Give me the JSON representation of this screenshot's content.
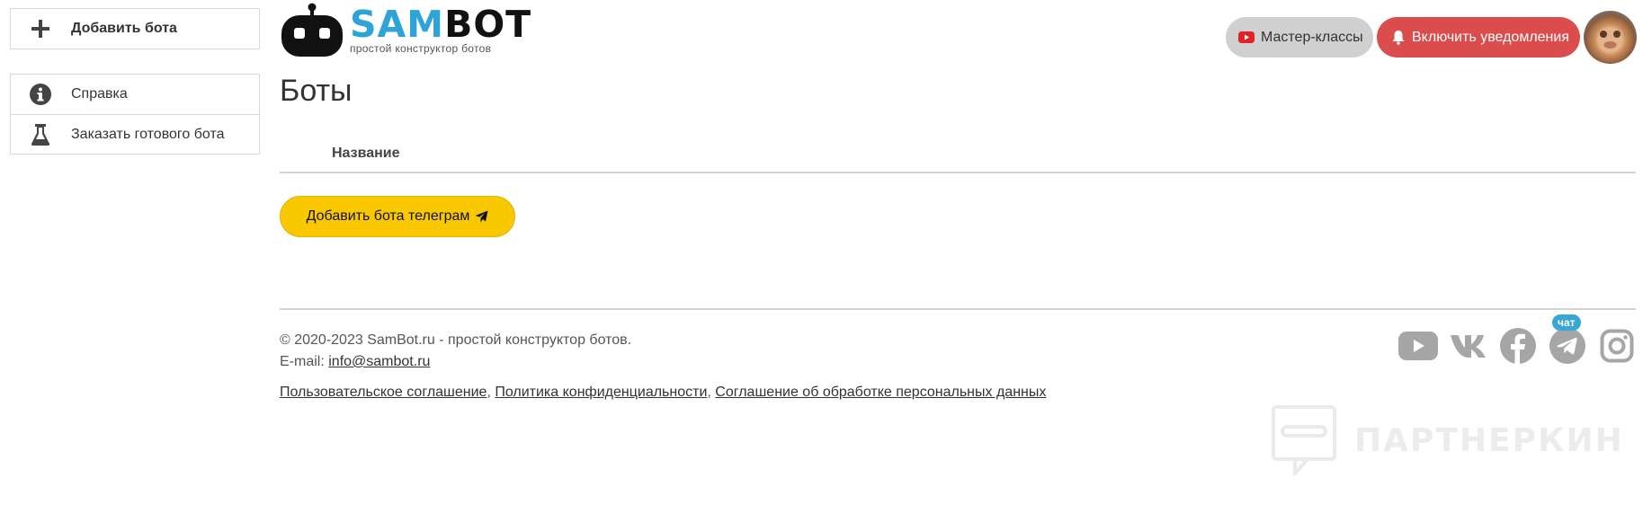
{
  "sidebar": {
    "add_bot": "Добавить бота",
    "items": [
      {
        "label": "Справка",
        "icon": "info-icon"
      },
      {
        "label": "Заказать готового бота",
        "icon": "flask-icon"
      }
    ]
  },
  "logo": {
    "sam": "SAM",
    "bot": "BOT",
    "tagline": "простой конструктор ботов"
  },
  "header": {
    "master_label": "Мастер-классы",
    "notify_label": "Включить уведомления"
  },
  "main": {
    "title": "Боты",
    "column_name": "Название",
    "add_telegram_label": "Добавить бота телеграм"
  },
  "footer": {
    "copyright": "© 2020-2023 SamBot.ru - простой конструктор ботов.",
    "email_label": "E-mail: ",
    "email": "info@sambot.ru",
    "links": [
      "Пользовательское соглашение",
      "Политика конфиденциальности",
      "Соглашение об обработке персональных данных"
    ],
    "chat_badge": "чат"
  },
  "watermark": "ПАРТНЕРКИН",
  "colors": {
    "brand_blue": "#2ea3d8",
    "notify_red": "#db4d4d",
    "telegram_yellow": "#f9c800",
    "social_gray": "#a6a6a6"
  }
}
